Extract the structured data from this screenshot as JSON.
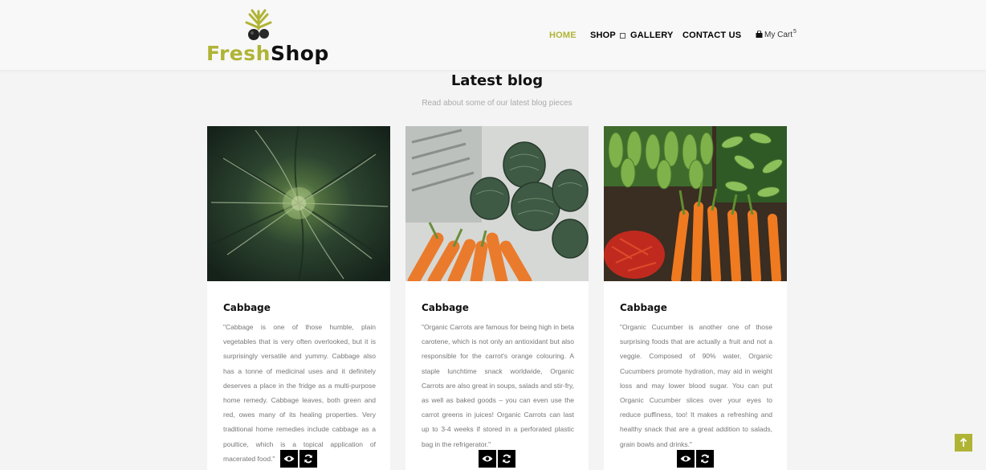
{
  "header": {
    "logo": {
      "part1": "Fresh",
      "part2": "Shop",
      "mark_icon": "olive-branch-icon",
      "brand_color": "#b0b435"
    },
    "nav": [
      {
        "label": "HOME",
        "active": true
      },
      {
        "label": "SHOP",
        "active": false,
        "dropdown_icon": "square-dropdown-icon"
      },
      {
        "label": "GALLERY",
        "active": false
      },
      {
        "label": "CONTACT US",
        "active": false
      }
    ],
    "cart": {
      "icon": "shopping-bag-icon",
      "label": "My Cart",
      "count": "5"
    }
  },
  "section": {
    "title": "Latest blog",
    "subtitle": "Read about some of our latest blog pieces"
  },
  "cards": [
    {
      "image": "cabbage-photo",
      "title": "Cabbage",
      "text": "\"Cabbage is one of those humble, plain vegetables that is very often overlooked, but it is surprisingly versatile and yummy. Cabbage also has a tonne of medicinal uses and it definitely deserves a place in the fridge as a multi-purpose home remedy. Cabbage leaves, both green and red, owes many of its healing properties. Very traditional home remedies include cabbage as a poultice, which is a topical application of macerated food.\""
    },
    {
      "image": "artichoke-carrots-photo",
      "title": "Cabbage",
      "text": "\"Organic Carrots are famous for being high in beta carotene, which is not only an antioxidant but also responsible for the carrot's orange colouring. A staple lunchtime snack worldwide, Organic Carrots are also great in soups, salads and stir-fry, as well as baked goods – you can even use the carrot greens in juices! Organic Carrots can last up to 3-4 weeks if stored in a perforated plastic bag in the refrigerator.\""
    },
    {
      "image": "market-vegetables-photo",
      "title": "Cabbage",
      "text": "\"Organic Cucumber is another one of those surprising foods that are actually a fruit and not a veggie. Composed of 90% water, Organic Cucumbers promote hydration, may aid in weight loss and may lower blood sugar. You can put Organic Cucumber slices over your eyes to reduce puffiness, too! It makes a refreshing and healthy snack that are a great addition to salads, grain bowls and drinks.\""
    }
  ],
  "card_actions": {
    "view_icon": "eye-icon",
    "sync_icon": "sync-icon"
  },
  "back_to_top": {
    "icon": "arrow-up-icon",
    "color": "#b0b435"
  }
}
